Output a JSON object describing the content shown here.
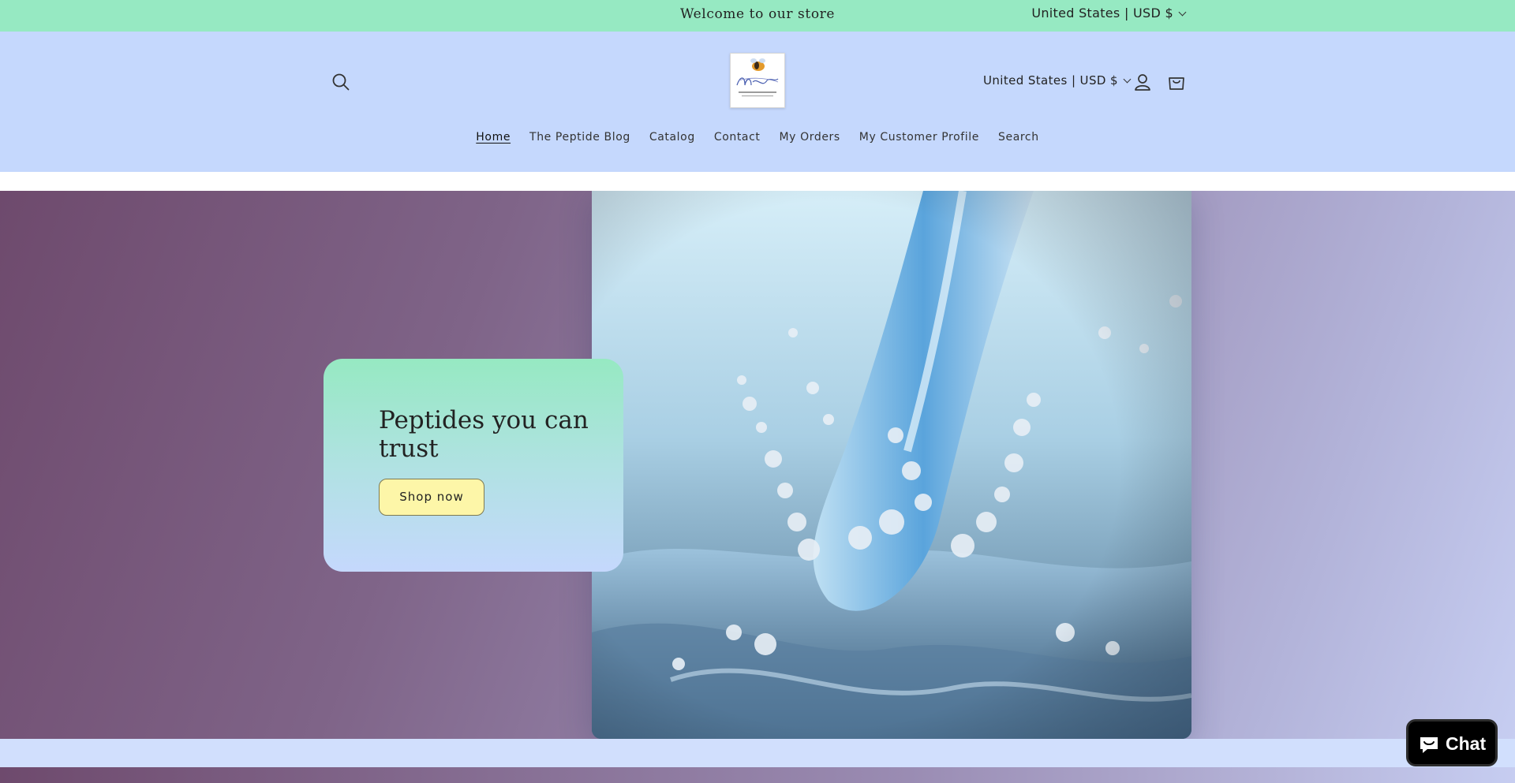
{
  "announcement": {
    "text": "Welcome to our store",
    "locale": "United States | USD $"
  },
  "header": {
    "logo_alt": "Peptide Therapy & Wellness logo",
    "locale": "United States | USD $",
    "icons": {
      "search": "search-icon",
      "account": "account-icon",
      "cart": "cart-icon"
    }
  },
  "nav": {
    "items": [
      {
        "label": "Home",
        "active": true
      },
      {
        "label": "The Peptide Blog"
      },
      {
        "label": "Catalog"
      },
      {
        "label": "Contact"
      },
      {
        "label": "My Orders"
      },
      {
        "label": "My Customer Profile"
      },
      {
        "label": "Search"
      }
    ]
  },
  "hero": {
    "heading": "Peptides you can trust",
    "button_label": "Shop now"
  },
  "chat": {
    "label": "Chat"
  },
  "colors": {
    "announcement_bg": "#96e9c2",
    "header_bg": "#c5d8fd",
    "button_bg": "#fdf6a8",
    "chat_bg": "#000000"
  }
}
